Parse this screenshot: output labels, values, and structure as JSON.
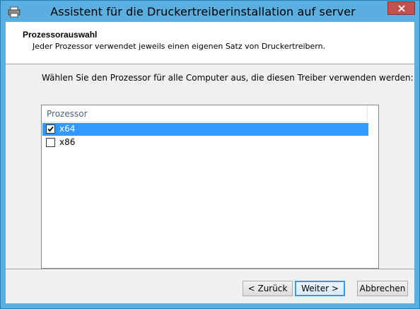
{
  "window": {
    "title": "Assistent für die Druckertreiberinstallation auf server"
  },
  "header": {
    "title": "Prozessorauswahl",
    "subtitle": "Jeder Prozessor verwendet jeweils einen eigenen Satz von Druckertreibern."
  },
  "instruction": "Wählen Sie den Prozessor für alle Computer aus, die diesen Treiber verwenden werden:",
  "list": {
    "column_header": "Prozessor",
    "items": [
      {
        "label": "x64",
        "checked": true,
        "selected": true
      },
      {
        "label": "x86",
        "checked": false,
        "selected": false
      }
    ]
  },
  "buttons": {
    "back": "< Zurück",
    "next": "Weiter >",
    "cancel": "Abbrechen"
  },
  "colors": {
    "titlebar": "#5aafe0",
    "selection": "#3399ff",
    "close_button": "#c7504f"
  },
  "icons": {
    "app": "printer-icon",
    "close": "close-icon",
    "check": "checkmark-icon"
  }
}
